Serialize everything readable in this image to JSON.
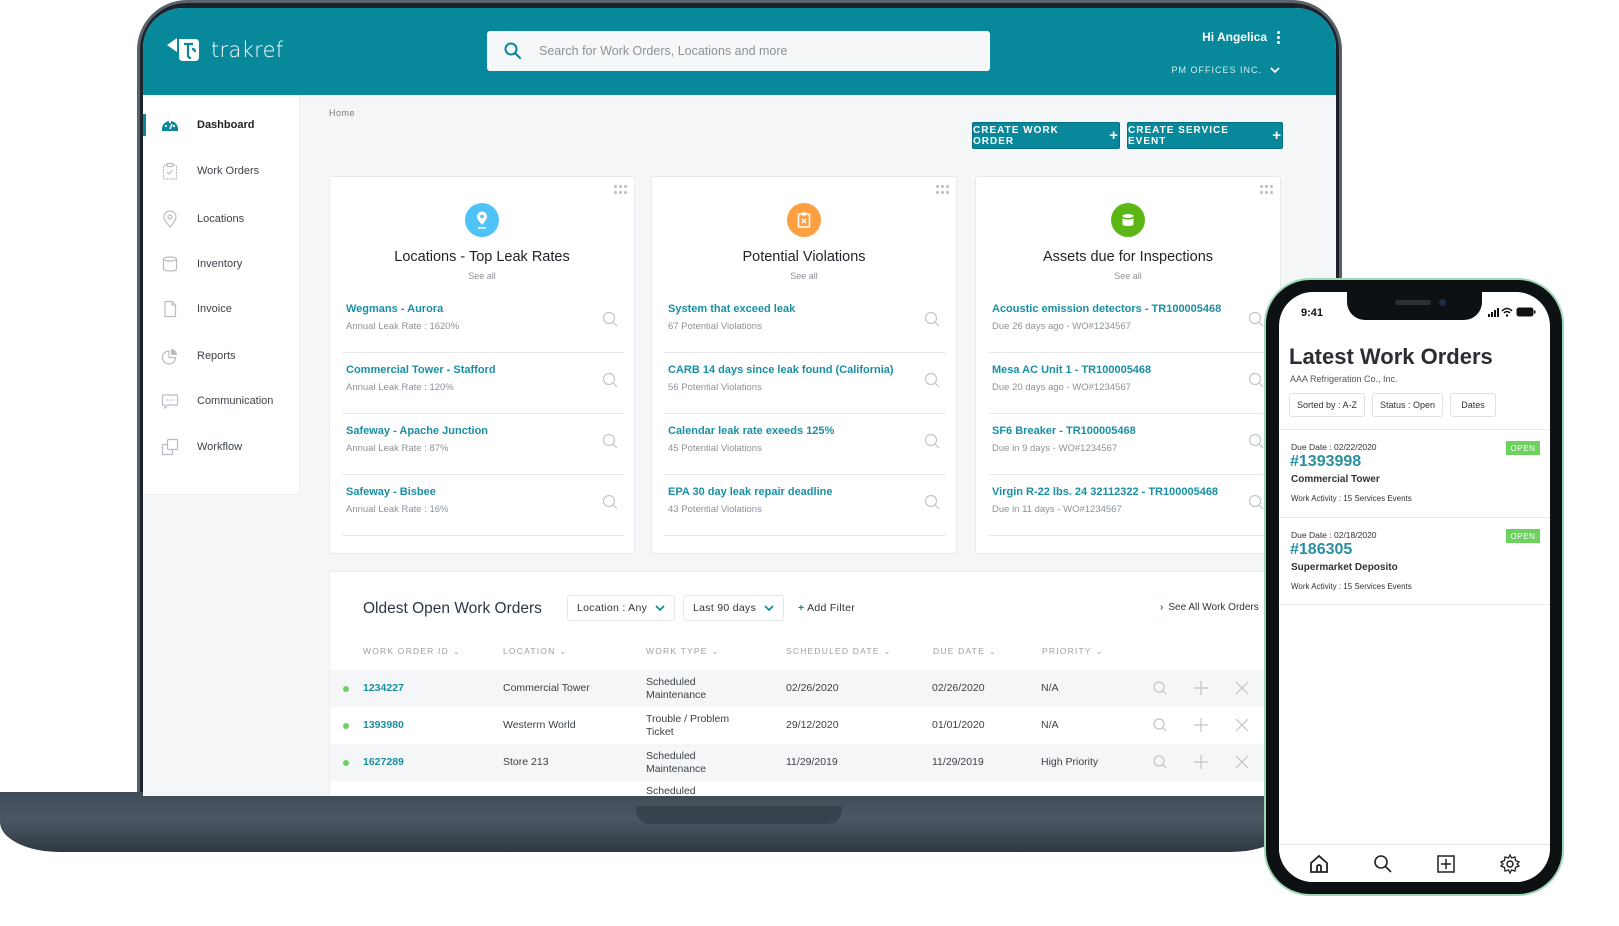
{
  "app": {
    "brand": "trakref",
    "brand_color": "#07889b",
    "search_placeholder": "Search for Work Orders, Locations and more",
    "greeting": "Hi Angelica",
    "organization": "PM OFFICES INC."
  },
  "sidebar": {
    "items": [
      {
        "label": "Dashboard",
        "icon": "dashboard-gauge-icon",
        "active": true
      },
      {
        "label": "Work Orders",
        "icon": "clipboard-check-icon",
        "active": false
      },
      {
        "label": "Locations",
        "icon": "map-pin-icon",
        "active": false
      },
      {
        "label": "Inventory",
        "icon": "cylinder-icon",
        "active": false
      },
      {
        "label": "Invoice",
        "icon": "document-icon",
        "active": false
      },
      {
        "label": "Reports",
        "icon": "pie-chart-icon",
        "active": false
      },
      {
        "label": "Communication",
        "icon": "chat-bubble-icon",
        "active": false
      },
      {
        "label": "Workflow",
        "icon": "copy-squares-icon",
        "active": false
      }
    ]
  },
  "breadcrumb": "Home",
  "actions": {
    "create_work_order": "CREATE WORK ORDER",
    "create_service_event": "CREATE SERVICE EVENT",
    "plus": "+"
  },
  "cards": [
    {
      "title": "Locations - Top Leak Rates",
      "see_all": "See all",
      "icon": "map-pin-icon",
      "color": "#4fc3f7",
      "rows": [
        {
          "title": "Wegmans - Aurora",
          "sub": "Annual Leak Rate : 1620%"
        },
        {
          "title": "Commercial Tower - Stafford",
          "sub": "Annual Leak Rate : 120%"
        },
        {
          "title": "Safeway - Apache Junction",
          "sub": "Annual Leak Rate : 87%"
        },
        {
          "title": "Safeway - Bisbee",
          "sub": "Annual Leak Rate : 16%"
        }
      ]
    },
    {
      "title": "Potential Violations",
      "see_all": "See all",
      "icon": "clipboard-x-icon",
      "color": "#ffa040",
      "rows": [
        {
          "title": "System that exceed leak",
          "sub": "67 Potential Violations"
        },
        {
          "title": "CARB 14 days since leak found (California)",
          "sub": "56 Potential Violations"
        },
        {
          "title": "Calendar leak rate exeeds 125%",
          "sub": "45 Potential Violations"
        },
        {
          "title": "EPA 30 day leak repair deadline",
          "sub": "43 Potential Violations"
        }
      ]
    },
    {
      "title": "Assets due for Inspections",
      "see_all": "See all",
      "icon": "cylinder-icon",
      "color": "#5cb615",
      "rows": [
        {
          "title": "Acoustic emission detectors - TR100005468",
          "sub": "Due 26 days ago - WO#1234567"
        },
        {
          "title": "Mesa AC Unit 1 - TR100005468",
          "sub": "Due 20 days ago - WO#1234567"
        },
        {
          "title": "SF6 Breaker - TR100005468",
          "sub": "Due in 9 days - WO#1234567"
        },
        {
          "title": "Virgin R-22 lbs. 24 32112322 - TR100005468",
          "sub": "Due in 11 days - WO#1234567"
        }
      ]
    }
  ],
  "work_orders": {
    "title": "Oldest Open Work Orders",
    "filter_location": "Location : Any",
    "filter_period": "Last 90 days",
    "add_filter": "Add Filter",
    "add_filter_plus": "+",
    "see_all": "See All Work Orders",
    "columns": [
      "WORK ORDER ID",
      "LOCATION",
      "WORK TYPE",
      "SCHEDULED DATE",
      "DUE DATE",
      "PRIORITY"
    ],
    "rows": [
      {
        "id": "1234227",
        "location": "Commercial Tower",
        "type_line1": "Scheduled",
        "type_line2": "Maintenance",
        "scheduled": "02/26/2020",
        "due": "02/26/2020",
        "priority": "N/A"
      },
      {
        "id": "1393980",
        "location": "Westerrn World",
        "type_line1": "Trouble / Problem",
        "type_line2": "Ticket",
        "scheduled": "29/12/2020",
        "due": "01/01/2020",
        "priority": "N/A"
      },
      {
        "id": "1627289",
        "location": "Store 213",
        "type_line1": "Scheduled",
        "type_line2": "Maintenance",
        "scheduled": "11/29/2019",
        "due": "11/29/2019",
        "priority": "High Priority"
      },
      {
        "id": "",
        "location": "",
        "type_line1": "Scheduled",
        "type_line2": "",
        "scheduled": "",
        "due": "",
        "priority": ""
      }
    ]
  },
  "phone": {
    "time": "9:41",
    "title": "Latest Work Orders",
    "company": "AAA Refrigeration Co., Inc.",
    "chips": [
      "Sorted by : A-Z",
      "Status : Open",
      "Dates"
    ],
    "orders": [
      {
        "due": "Due Date : 02/22/2020",
        "id": "#1393998",
        "location": "Commercial Tower",
        "activity": "Work Activity : 15 Services Events",
        "status": "OPEN"
      },
      {
        "due": "Due Date : 02/18/2020",
        "id": "#186305",
        "location": "Supermarket Deposito",
        "activity": "Work Activity : 15 Services Events",
        "status": "OPEN"
      }
    ],
    "nav": [
      "home-icon",
      "search-icon",
      "add-square-icon",
      "settings-gear-icon"
    ]
  }
}
